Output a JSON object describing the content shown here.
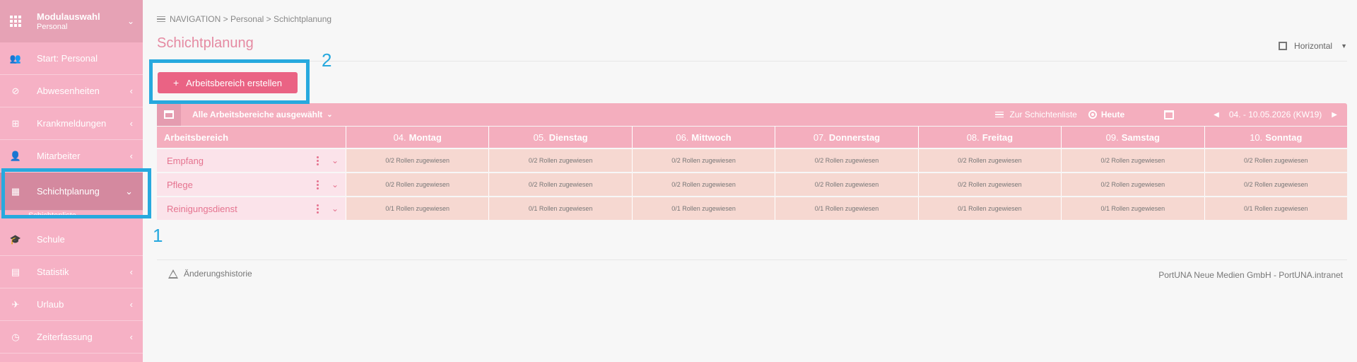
{
  "sidebar": {
    "module_title": "Modulauswahl",
    "module_sub": "Personal",
    "items": [
      {
        "label": "Start: Personal",
        "icon": "people-icon",
        "arrow": ""
      },
      {
        "label": "Abwesenheiten",
        "icon": "block-icon",
        "arrow": "‹"
      },
      {
        "label": "Krankmeldungen",
        "icon": "plus-box-icon",
        "arrow": "‹"
      },
      {
        "label": "Mitarbeiter",
        "icon": "person-icon",
        "arrow": "‹"
      },
      {
        "label": "Schichtplanung",
        "icon": "calendar-icon",
        "arrow": "⌄"
      },
      {
        "label": "Schule",
        "icon": "school-icon",
        "arrow": ""
      },
      {
        "label": "Statistik",
        "icon": "chart-icon",
        "arrow": "‹"
      },
      {
        "label": "Urlaub",
        "icon": "plane-icon",
        "arrow": "‹"
      },
      {
        "label": "Zeiterfassung",
        "icon": "clock-icon",
        "arrow": "‹"
      }
    ],
    "sub_item": "Schichtenliste"
  },
  "breadcrumb": {
    "nav": "NAVIGATION",
    "sep": ">",
    "level1": "Personal",
    "level2": "Schichtplanung"
  },
  "page": {
    "title": "Schichtplanung",
    "view_mode": "Horizontal",
    "add_button": "Arbeitsbereich erstellen",
    "add_plus": "+"
  },
  "markers": {
    "one": "1",
    "two": "2"
  },
  "toolbar": {
    "filter": "Alle Arbeitsbereiche ausgewählt",
    "list_link": "Zur Schichtenliste",
    "today": "Heute",
    "prev": "◀",
    "next": "▶",
    "range": "04. - 10.05.2026 (KW19)"
  },
  "grid": {
    "first_col": "Arbeitsbereich",
    "days": [
      {
        "num": "04.",
        "name": "Montag"
      },
      {
        "num": "05.",
        "name": "Dienstag"
      },
      {
        "num": "06.",
        "name": "Mittwoch"
      },
      {
        "num": "07.",
        "name": "Donnerstag"
      },
      {
        "num": "08.",
        "name": "Freitag"
      },
      {
        "num": "09.",
        "name": "Samstag"
      },
      {
        "num": "10.",
        "name": "Sonntag"
      }
    ],
    "rows": [
      {
        "name": "Empfang",
        "cells": [
          "0/2 Rollen zugewiesen",
          "0/2 Rollen zugewiesen",
          "0/2 Rollen zugewiesen",
          "0/2 Rollen zugewiesen",
          "0/2 Rollen zugewiesen",
          "0/2 Rollen zugewiesen",
          "0/2 Rollen zugewiesen"
        ]
      },
      {
        "name": "Pflege",
        "cells": [
          "0/2 Rollen zugewiesen",
          "0/2 Rollen zugewiesen",
          "0/2 Rollen zugewiesen",
          "0/2 Rollen zugewiesen",
          "0/2 Rollen zugewiesen",
          "0/2 Rollen zugewiesen",
          "0/2 Rollen zugewiesen"
        ]
      },
      {
        "name": "Reinigungsdienst",
        "cells": [
          "0/1 Rollen zugewiesen",
          "0/1 Rollen zugewiesen",
          "0/1 Rollen zugewiesen",
          "0/1 Rollen zugewiesen",
          "0/1 Rollen zugewiesen",
          "0/1 Rollen zugewiesen",
          "0/1 Rollen zugewiesen"
        ]
      }
    ]
  },
  "footer": {
    "history": "Änderungshistorie",
    "company": "PortUNA Neue Medien GmbH - PortUNA.intranet"
  },
  "colors": {
    "sidebar_bg": "#f6b1c5",
    "accent": "#ea6384",
    "highlight": "#27a9de"
  }
}
